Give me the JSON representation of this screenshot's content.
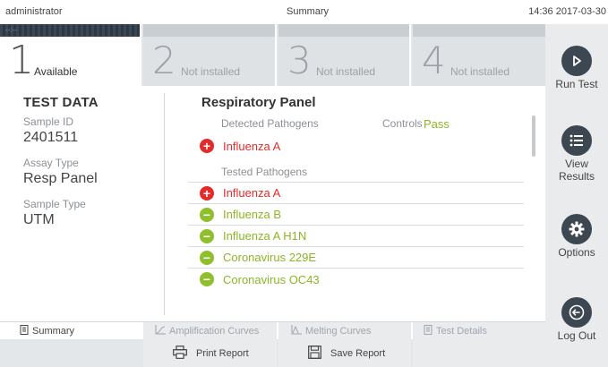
{
  "topbar": {
    "user": "administrator",
    "title": "Summary",
    "time": "14:36 2017-03-30"
  },
  "slots": [
    {
      "number": "1",
      "label": "Available",
      "indicator": "--:--"
    },
    {
      "number": "2",
      "label": "Not installed"
    },
    {
      "number": "3",
      "label": "Not installed"
    },
    {
      "number": "4",
      "label": "Not installed"
    }
  ],
  "sidebar": {
    "run_test": "Run Test",
    "view_results": "View Results",
    "options": "Options",
    "log_out": "Log Out"
  },
  "test_data": {
    "header": "TEST DATA",
    "sample_id_label": "Sample ID",
    "sample_id": "2401511",
    "assay_type_label": "Assay Type",
    "assay_type": "Resp Panel",
    "sample_type_label": "Sample Type",
    "sample_type": "UTM"
  },
  "panel": {
    "title": "Respiratory Panel",
    "detected_label": "Detected Pathogens",
    "controls_label": "Controls",
    "controls_value": "Pass",
    "detected": [
      {
        "name": "Influenza A",
        "result": "positive"
      }
    ],
    "tested_label": "Tested Pathogens",
    "tested": [
      {
        "name": "Influenza A",
        "result": "positive"
      },
      {
        "name": "Influenza B",
        "result": "negative"
      },
      {
        "name": "Influenza A H1N",
        "result": "negative"
      },
      {
        "name": "Coronavirus 229E",
        "result": "negative"
      },
      {
        "name": "Coronavirus OC43",
        "result": "negative"
      }
    ]
  },
  "bottom_tabs": {
    "summary": "Summary",
    "amplification": "Amplification Curves",
    "melting": "Melting Curves",
    "details": "Test Details"
  },
  "actions": {
    "print": "Print Report",
    "save": "Save Report"
  },
  "colors": {
    "positive": "#e32b2b",
    "negative": "#8cb526",
    "pass": "#8cb526",
    "dark": "#3c4752"
  }
}
